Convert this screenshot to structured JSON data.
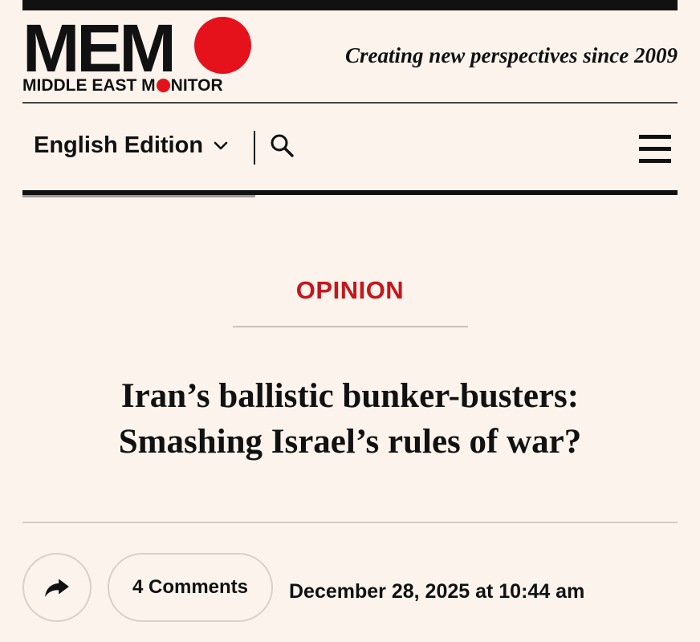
{
  "header": {
    "logo_text": "MEM",
    "logo_subtitle_before": "MIDDLE EAST M",
    "logo_subtitle_after": "NITOR",
    "tagline": "Creating new perspectives since 2009"
  },
  "nav": {
    "edition_label": "English Edition",
    "edition_icon": "chevron-down-icon",
    "search_icon": "search-icon",
    "menu_icon": "hamburger-menu-icon"
  },
  "article": {
    "category": "OPINION",
    "headline_line1": "Iran’s ballistic bunker-busters:",
    "headline_line2": "Smashing Israel’s rules of war?",
    "comments_label": "4 Comments",
    "date": "December 28, 2025 at 10:44 am",
    "share_icon": "share-arrow-icon"
  },
  "colors": {
    "background": "#fbf3ec",
    "brand_red": "#e5121b",
    "category_red": "#c4161c",
    "text": "#111111"
  }
}
